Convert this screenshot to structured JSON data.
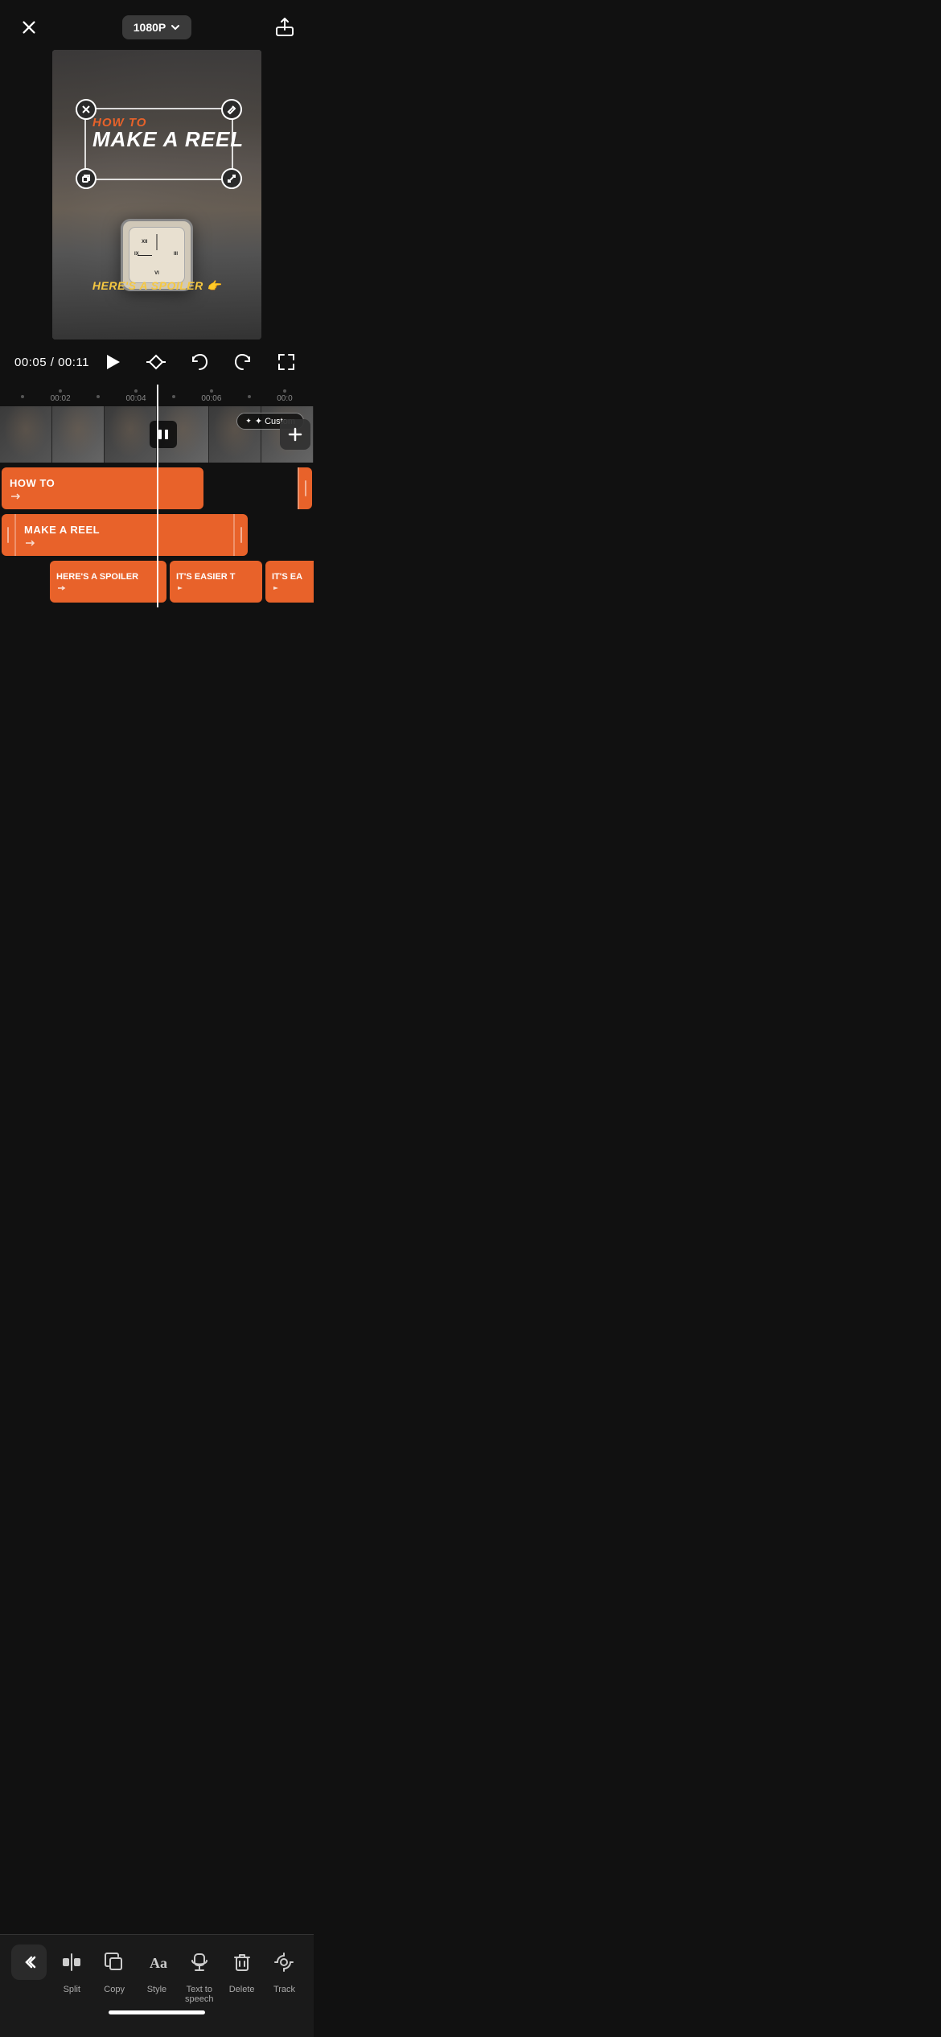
{
  "topBar": {
    "closeLabel": "✕",
    "resolution": "1080P",
    "resolutionArrow": "▾"
  },
  "timeDisplay": {
    "current": "00:05",
    "separator": "/",
    "total": "00:11"
  },
  "rulerMarks": [
    {
      "label": "00:02"
    },
    {
      "label": "00:04"
    },
    {
      "label": "00:06"
    },
    {
      "label": "00:0"
    }
  ],
  "videoOverlay": {
    "howTo": "HOW TO",
    "makeReel": "MAKE A REEL",
    "spoiler": "HERE'S A SPOILER 👉"
  },
  "customBadge": "✦ Custom",
  "tracks": {
    "row1": {
      "label": "HOW TO"
    },
    "row2": {
      "label": "MAKE A REEL"
    },
    "row3a": {
      "label": "HERE'S A SPOILER"
    },
    "row3b": {
      "label": "IT'S EASIER T"
    },
    "row3c": {
      "label": "IT'S EA"
    }
  },
  "toolbar": {
    "items": [
      {
        "id": "back",
        "label": "",
        "icon": "back"
      },
      {
        "id": "split",
        "label": "Split",
        "icon": "split"
      },
      {
        "id": "copy",
        "label": "Copy",
        "icon": "copy"
      },
      {
        "id": "style",
        "label": "Style",
        "icon": "style"
      },
      {
        "id": "tts",
        "label": "Text to\nspeech",
        "icon": "tts"
      },
      {
        "id": "delete",
        "label": "Delete",
        "icon": "delete"
      },
      {
        "id": "track",
        "label": "Track",
        "icon": "track"
      }
    ]
  }
}
